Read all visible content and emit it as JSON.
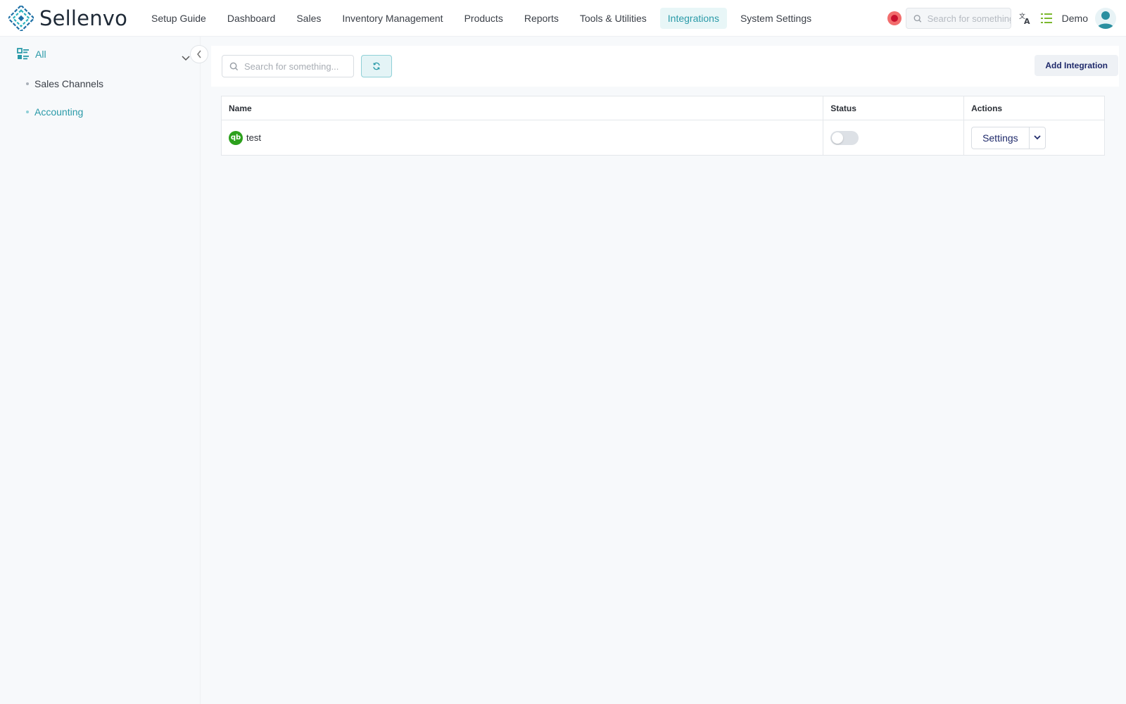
{
  "app": {
    "brand_name": "Sellenvo",
    "user_name": "Demo"
  },
  "nav": {
    "items": [
      {
        "label": "Setup Guide",
        "active": false
      },
      {
        "label": "Dashboard",
        "active": false
      },
      {
        "label": "Sales",
        "active": false
      },
      {
        "label": "Inventory Management",
        "active": false
      },
      {
        "label": "Products",
        "active": false
      },
      {
        "label": "Reports",
        "active": false
      },
      {
        "label": "Tools & Utilities",
        "active": false
      },
      {
        "label": "Integrations",
        "active": true
      },
      {
        "label": "System Settings",
        "active": false
      }
    ]
  },
  "top_search": {
    "placeholder": "Search for something...",
    "value": ""
  },
  "icons": {
    "record": "record-icon",
    "search": "search-icon",
    "translate": "translate-icon",
    "list": "list-icon",
    "avatar": "user-avatar-icon",
    "chevron_down": "chevron-down-icon",
    "collapse": "chevron-left-icon",
    "refresh": "refresh-icon",
    "categories": "category-list-icon",
    "quickbooks": "quickbooks-logo"
  },
  "sidebar": {
    "all_label": "All",
    "items": [
      {
        "label": "Sales Channels",
        "active": false
      },
      {
        "label": "Accounting",
        "active": true
      }
    ]
  },
  "toolbar": {
    "search_placeholder": "Search for something...",
    "search_value": "",
    "add_label": "Add Integration"
  },
  "table": {
    "columns": [
      "Name",
      "Status",
      "Actions"
    ],
    "rows": [
      {
        "logo_text": "qb",
        "name": "test",
        "status_on": false,
        "action_label": "Settings"
      }
    ]
  },
  "colors": {
    "accent": "#2a9aa8",
    "accent_bg": "#e8f6f7",
    "quickbooks_green": "#2ca01c",
    "record_red": "#f26d6d",
    "button_text": "#1f2a6b"
  }
}
